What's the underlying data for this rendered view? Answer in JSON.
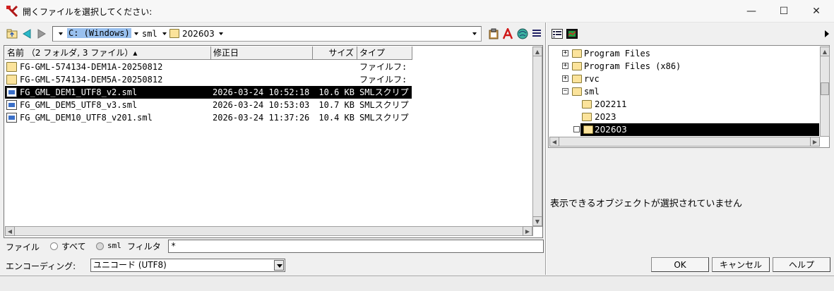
{
  "window": {
    "title": "開くファイルを選択してください:",
    "minimize": "—",
    "maximize": "☐",
    "close": "✕"
  },
  "toolbar": {
    "path": {
      "drive": "C: (Windows)",
      "dir1": "sml",
      "dir2": "202603"
    }
  },
  "filelist": {
    "columns": {
      "name": "名前 （2 フォルダ, 3 ファイル）▴",
      "modified": "修正日",
      "size": "サイズ",
      "type": "タイプ"
    },
    "rows": [
      {
        "name": "FG-GML-574134-DEM1A-20250812",
        "modified": "",
        "size": "",
        "type": "ファイルフ:",
        "kind": "folder"
      },
      {
        "name": "FG-GML-574134-DEM5A-20250812",
        "modified": "",
        "size": "",
        "type": "ファイルフ:",
        "kind": "folder"
      },
      {
        "name": "FG_GML_DEM1_UTF8_v2.sml",
        "modified": "2026-03-24 10:52:18",
        "size": "10.6 KB",
        "type": "SMLスクリプ",
        "kind": "sml"
      },
      {
        "name": "FG_GML_DEM5_UTF8_v3.sml",
        "modified": "2026-03-24 10:53:03",
        "size": "10.7 KB",
        "type": "SMLスクリプ",
        "kind": "sml"
      },
      {
        "name": "FG_GML_DEM10_UTF8_v201.sml",
        "modified": "2026-03-24 11:37:26",
        "size": "10.4 KB",
        "type": "SMLスクリプ",
        "kind": "sml"
      }
    ]
  },
  "tree": {
    "nodes": [
      {
        "label": "Program Files",
        "box": "+"
      },
      {
        "label": "Program Files (x86)",
        "box": "+"
      },
      {
        "label": "rvc",
        "box": "+"
      },
      {
        "label": "sml",
        "box": "−"
      },
      {
        "label": "202211",
        "box": ""
      },
      {
        "label": "2023",
        "box": ""
      },
      {
        "label": "202603",
        "box": "−"
      }
    ]
  },
  "info_panel": {
    "message": "表示できるオブジェクトが選択されていません"
  },
  "filter": {
    "label_file": "ファイル",
    "option_all": "すべて",
    "option_sml": "sml",
    "label_filter": "フィルタ",
    "value": "*"
  },
  "encoding": {
    "label": "エンコーディング:",
    "value": "ユニコード (UTF8)"
  },
  "buttons": {
    "ok": "OK",
    "cancel": "キャンセル",
    "help": "ヘルプ"
  }
}
